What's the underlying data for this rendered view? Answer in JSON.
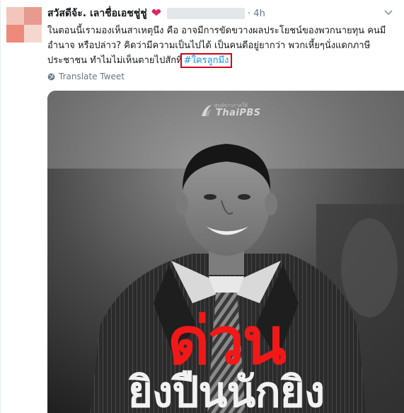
{
  "tweet": {
    "author_name": "สวัสดีจ้ะ. เลาชื่อเอชชู่ชู่",
    "author_emoji": "heart-icon",
    "time": "· 4h",
    "text_lines": [
      "ในตอนนี้เรามองเห็นสาเหตุนึง คือ อาจมีการขัดขวางผลประโยชน์ของพวกนายทุน คนมี",
      "อำนาจ หรือปล่าว? คิดว่ามีความเป็นไปได้ เป็นคนดีอยู่ยากว่า พวกเหี้ยๆนั่งแดกภาษี",
      "ประชาชน ทำไมไม่เห็นตายไปสักที"
    ],
    "hashtag": "#ใครลูกมึง",
    "translate_label": "Translate Tweet"
  },
  "media": {
    "watermark_small": "ศูนย์ข่าวภาคใต้",
    "watermark_brand": "ThaiPBS",
    "headline_main": "ด่วน",
    "headline_sub": "ยิงปืนนักยิง",
    "headline_color": "#f21818"
  },
  "colors": {
    "link": "#1b95e0",
    "muted": "#657786",
    "highlight_box": "#d0021b"
  }
}
